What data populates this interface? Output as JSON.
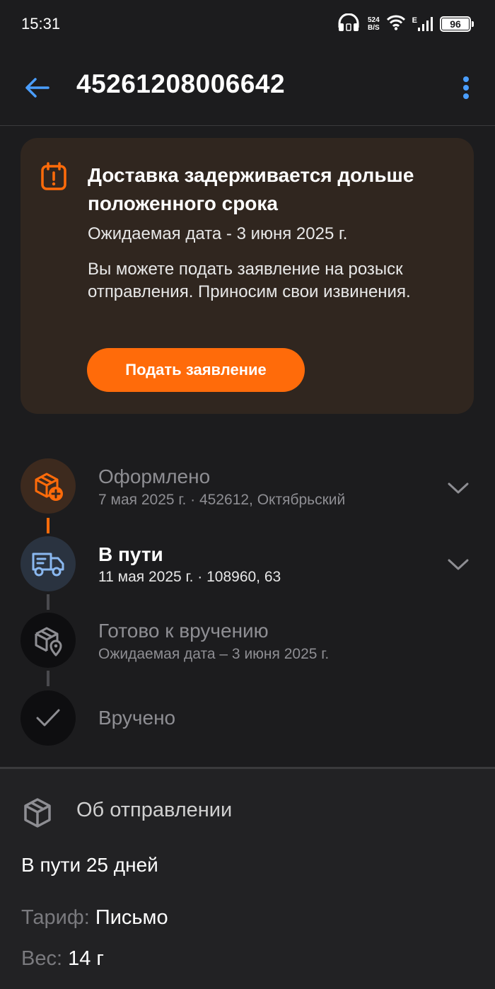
{
  "status_bar": {
    "time": "15:31",
    "net_speed_value": "524",
    "net_speed_unit": "B/S",
    "network_type": "E",
    "battery": "96"
  },
  "app_bar": {
    "title": "45261208006642",
    "back_icon": "arrow-left-icon",
    "more_icon": "more-vertical-icon"
  },
  "alert": {
    "icon": "calendar-alert-icon",
    "title": "Доставка задерживается дольше положенного срока",
    "expected_date": "Ожидаемая дата - 3 июня 2025 г.",
    "text": "Вы можете подать заявление на розыск отправления. Приносим свои извинения.",
    "button_label": "Подать заявление"
  },
  "timeline": {
    "steps": [
      {
        "icon": "package-plus-icon",
        "title": "Оформлено",
        "subtitle": "7 мая 2025 г. · 452612, Октябрьский",
        "state": "done"
      },
      {
        "icon": "truck-icon",
        "title": "В пути",
        "subtitle": "11 мая 2025 г. · 108960, 63",
        "state": "current"
      },
      {
        "icon": "package-location-icon",
        "title": "Готово к вручению",
        "subtitle": "Ожидаемая дата – 3 июня 2025 г.",
        "state": "pending"
      },
      {
        "icon": "check-icon",
        "title": "Вручено",
        "state": "pending"
      }
    ]
  },
  "shipment_info": {
    "icon": "package-icon",
    "heading": "Об отправлении",
    "duration": "В пути 25 дней",
    "tariff_label": "Тариф:",
    "tariff_value": "Письмо",
    "weight_label": "Вес:",
    "weight_value": "14 г"
  },
  "colors": {
    "background": "#1c1c1e",
    "accent_orange": "#ff6b0a",
    "alert_bg": "#30261f",
    "link_blue": "#4a9eff",
    "truck_blue": "#8ab8f0"
  }
}
